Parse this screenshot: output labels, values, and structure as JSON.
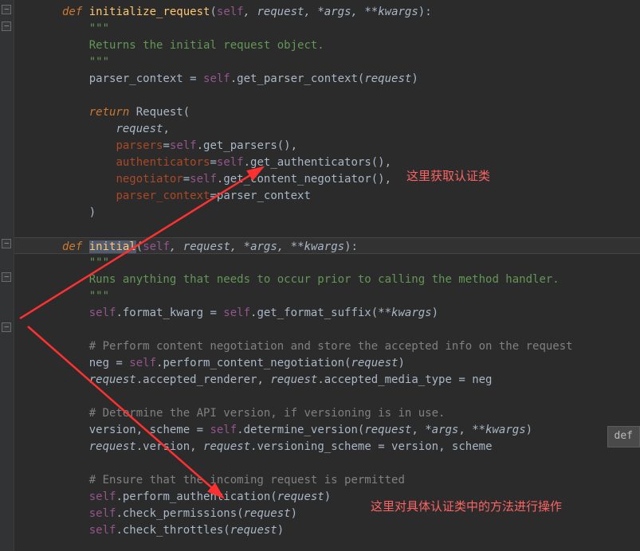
{
  "code": {
    "method1": {
      "def": "def",
      "name": "initialize_request",
      "params_open": "(",
      "self": "self",
      "comma": ", ",
      "request": "request",
      "args": "*args",
      "kwargs": "**kwargs",
      "params_close": "):",
      "docstring_open": "\"\"\"",
      "docstring_line": "Returns the initial request object.",
      "docstring_close": "\"\"\"",
      "line1_a": "parser_context = ",
      "line1_b": "self",
      "line1_c": ".get_parser_context(",
      "line1_d": "request",
      "line1_e": ")",
      "return": "return",
      "cls": " Request(",
      "arg1": "request",
      "arg1_comma": ",",
      "parsers_k": "parsers",
      "eq": "=",
      "parsers_v": ".get_parsers()",
      "parsers_comma": ",",
      "auth_k": "authenticators",
      "auth_v": ".get_authenticators()",
      "auth_comma": ",",
      "neg_k": "negotiator",
      "neg_v": ".get_content_negotiator()",
      "neg_comma": ",",
      "pctx_k": "parser_context",
      "pctx_v": "parser_context",
      "close_paren": ")"
    },
    "method2": {
      "def": "def",
      "name": "initial",
      "params": "(self, request, *args, **kwargs):",
      "docstring_open": "\"\"\"",
      "docstring_line": "Runs anything that needs to occur prior to calling the method handler.",
      "docstring_close": "\"\"\"",
      "fmt_a": "self",
      "fmt_b": ".format_kwarg = ",
      "fmt_c": "self",
      "fmt_d": ".get_format_suffix(",
      "fmt_e": "**",
      "fmt_f": "kwargs",
      "fmt_g": ")",
      "comment1": "# Perform content negotiation and store the accepted info on the request",
      "neg_a": "neg = ",
      "neg_b": "self",
      "neg_c": ".perform_content_negotiation(",
      "neg_d": "request",
      "neg_e": ")",
      "acc_a": "request",
      "acc_b": ".accepted_renderer",
      "acc_c": ", ",
      "acc_d": "request",
      "acc_e": ".accepted_media_type = neg",
      "comment2": "# Determine the API version, if versioning is in use.",
      "ver_a": "version",
      "ver_b": ", ",
      "ver_c": "scheme = ",
      "ver_d": "self",
      "ver_e": ".determine_version(",
      "ver_f": "request",
      "ver_g": ", ",
      "ver_h": "*args",
      "ver_i": ", ",
      "ver_j": "**kwargs",
      "ver_k": ")",
      "rv_a": "request",
      "rv_b": ".version",
      "rv_c": ", ",
      "rv_d": "request",
      "rv_e": ".versioning_scheme = version",
      "rv_f": ", ",
      "rv_g": "scheme",
      "comment3": "# Ensure that the incoming request is permitted",
      "pa_a": "self",
      "pa_b": ".perform_authentication(",
      "pa_c": "request",
      "pa_d": ")",
      "cp_a": "self",
      "cp_b": ".check_permissions(",
      "cp_c": "request",
      "cp_d": ")",
      "ct_a": "self",
      "ct_b": ".check_throttles(",
      "ct_c": "request",
      "ct_d": ")"
    }
  },
  "annotations": {
    "a1": "这里获取认证类",
    "a2": "这里对具体认证类中的方法进行操作"
  },
  "popup": {
    "text": "def"
  }
}
